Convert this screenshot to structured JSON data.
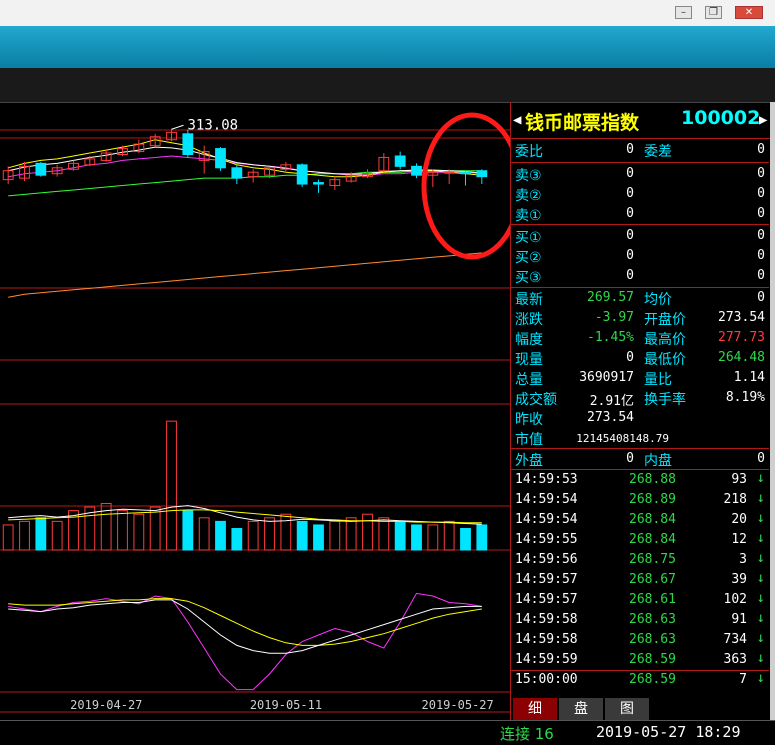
{
  "window": {
    "buttons": [
      "minimize",
      "restore",
      "close"
    ]
  },
  "chart_data": [
    {
      "type": "candlestick",
      "title": "",
      "high_label": "313.08",
      "x_dates": [
        "2019-04-27",
        "2019-05-11",
        "2019-05-27"
      ],
      "candles": [
        {
          "o": 279,
          "c": 285,
          "h": 288,
          "l": 276,
          "up": true
        },
        {
          "o": 280,
          "c": 288,
          "h": 291,
          "l": 278,
          "up": true
        },
        {
          "o": 290,
          "c": 282,
          "h": 291,
          "l": 281,
          "up": false
        },
        {
          "o": 283,
          "c": 287,
          "h": 289,
          "l": 281,
          "up": true
        },
        {
          "o": 286,
          "c": 290,
          "h": 292,
          "l": 285,
          "up": true
        },
        {
          "o": 289,
          "c": 293,
          "h": 295,
          "l": 288,
          "up": true
        },
        {
          "o": 292,
          "c": 297,
          "h": 299,
          "l": 291,
          "up": true
        },
        {
          "o": 296,
          "c": 300,
          "h": 302,
          "l": 295,
          "up": true
        },
        {
          "o": 298,
          "c": 303,
          "h": 306,
          "l": 297,
          "up": true
        },
        {
          "o": 302,
          "c": 308,
          "h": 310,
          "l": 301,
          "up": true
        },
        {
          "o": 306,
          "c": 311,
          "h": 313.08,
          "l": 305,
          "up": true
        },
        {
          "o": 310,
          "c": 296,
          "h": 313,
          "l": 294,
          "up": false
        },
        {
          "o": 298,
          "c": 292,
          "h": 302,
          "l": 283,
          "up": true
        },
        {
          "o": 300,
          "c": 287,
          "h": 301,
          "l": 285,
          "up": false
        },
        {
          "o": 287,
          "c": 280,
          "h": 289,
          "l": 276,
          "up": false
        },
        {
          "o": 281,
          "c": 284,
          "h": 286,
          "l": 277,
          "up": true
        },
        {
          "o": 282,
          "c": 287,
          "h": 288,
          "l": 280,
          "up": true
        },
        {
          "o": 286,
          "c": 289,
          "h": 291,
          "l": 284,
          "up": true
        },
        {
          "o": 289,
          "c": 276,
          "h": 290,
          "l": 274,
          "up": false
        },
        {
          "o": 277,
          "c": 276,
          "h": 279,
          "l": 270,
          "up": false
        },
        {
          "o": 275,
          "c": 279,
          "h": 281,
          "l": 272,
          "up": true
        },
        {
          "o": 278,
          "c": 282,
          "h": 284,
          "l": 277,
          "up": true
        },
        {
          "o": 281,
          "c": 283,
          "h": 286,
          "l": 280,
          "up": true
        },
        {
          "o": 285,
          "c": 294,
          "h": 297,
          "l": 284,
          "up": true
        },
        {
          "o": 295,
          "c": 288,
          "h": 298,
          "l": 286,
          "up": false
        },
        {
          "o": 288,
          "c": 282,
          "h": 290,
          "l": 280,
          "up": false
        },
        {
          "o": 282,
          "c": 284,
          "h": 286,
          "l": 274,
          "up": true
        },
        {
          "o": 284,
          "c": 284,
          "h": 286,
          "l": 276,
          "up": true
        },
        {
          "o": 284,
          "c": 283,
          "h": 285,
          "l": 275,
          "up": false
        },
        {
          "o": 285,
          "c": 281,
          "h": 286,
          "l": 276,
          "up": false
        }
      ],
      "ma5": [
        287,
        290,
        292,
        293,
        295,
        297,
        299,
        301,
        303,
        306,
        304,
        302,
        297,
        293,
        289,
        287,
        286,
        284,
        283,
        282,
        281,
        281,
        282,
        284,
        285,
        285,
        285,
        284,
        283,
        282
      ],
      "ma10": [
        281,
        283,
        284,
        285,
        287,
        289,
        290,
        292,
        293,
        294,
        295,
        294,
        293,
        292,
        290,
        289,
        288,
        287,
        285,
        284,
        283,
        282,
        282,
        283,
        283,
        284,
        284,
        284,
        284,
        283
      ],
      "ma20": [
        268,
        269,
        270,
        271,
        272,
        273,
        274,
        275,
        276,
        277,
        278,
        279,
        280,
        280,
        280,
        281,
        281,
        282,
        282,
        283,
        283,
        283,
        284,
        284,
        284,
        285,
        285,
        285,
        285,
        285
      ],
      "ma60": [
        240,
        242,
        243,
        244,
        245,
        246,
        247,
        248,
        249,
        250,
        251,
        252,
        253,
        254,
        255,
        256,
        257,
        258,
        259,
        260,
        261,
        262,
        263,
        264,
        265,
        266,
        267,
        268,
        269,
        270
      ],
      "volume": [
        35,
        40,
        45,
        40,
        55,
        60,
        65,
        55,
        50,
        60,
        180,
        55,
        45,
        40,
        30,
        40,
        45,
        50,
        40,
        35,
        40,
        45,
        50,
        45,
        40,
        35,
        35,
        40,
        30,
        35
      ],
      "vol_ma5": [
        45,
        47,
        48,
        46,
        48,
        52,
        55,
        57,
        56,
        55,
        60,
        62,
        58,
        52,
        46,
        42,
        40,
        41,
        43,
        42,
        41,
        40,
        41,
        42,
        41,
        40,
        39,
        38,
        37,
        36
      ],
      "vol_ma10": [
        42,
        43,
        44,
        45,
        46,
        48,
        50,
        51,
        52,
        53,
        55,
        56,
        56,
        55,
        53,
        51,
        49,
        47,
        45,
        43,
        42,
        41,
        41,
        40,
        40,
        39,
        39,
        39,
        38,
        38
      ],
      "osc_main": [
        72,
        70,
        68,
        72,
        75,
        76,
        78,
        76,
        74,
        80,
        78,
        60,
        40,
        20,
        8,
        8,
        20,
        35,
        45,
        50,
        55,
        52,
        45,
        40,
        60,
        82,
        80,
        75,
        74,
        72
      ],
      "osc_k": [
        70,
        69,
        68,
        70,
        71,
        73,
        74,
        75,
        75,
        77,
        77,
        70,
        60,
        50,
        42,
        38,
        36,
        36,
        38,
        42,
        46,
        50,
        54,
        58,
        62,
        66,
        70,
        71,
        72,
        72
      ],
      "osc_d": [
        74,
        73,
        73,
        73,
        74,
        75,
        76,
        77,
        77,
        78,
        78,
        76,
        71,
        65,
        59,
        53,
        48,
        44,
        42,
        42,
        43,
        45,
        48,
        51,
        55,
        59,
        63,
        66,
        68,
        70
      ]
    }
  ],
  "quote": {
    "name": "钱币邮票指数",
    "code": "100002",
    "weibi_label": "委比",
    "weibi_val": "0",
    "weicha_label": "委差",
    "weicha_val": "0",
    "asks": [
      {
        "label": "卖③",
        "price": "0",
        "vol": "0"
      },
      {
        "label": "卖②",
        "price": "0",
        "vol": "0"
      },
      {
        "label": "卖①",
        "price": "0",
        "vol": "0"
      }
    ],
    "bids": [
      {
        "label": "买①",
        "price": "0",
        "vol": "0"
      },
      {
        "label": "买②",
        "price": "0",
        "vol": "0"
      },
      {
        "label": "买③",
        "price": "0",
        "vol": "0"
      }
    ],
    "stats": [
      {
        "l1": "最新",
        "v1": "269.57",
        "c1": "#2fd84a",
        "l2": "均价",
        "v2": "0",
        "c2": "#fff"
      },
      {
        "l1": "涨跌",
        "v1": "-3.97",
        "c1": "#2fd84a",
        "l2": "开盘价",
        "v2": "273.54",
        "c2": "#fff"
      },
      {
        "l1": "幅度",
        "v1": "-1.45%",
        "c1": "#2fd84a",
        "l2": "最高价",
        "v2": "277.73",
        "c2": "#ff3b3b"
      },
      {
        "l1": "现量",
        "v1": "0",
        "c1": "#fff",
        "l2": "最低价",
        "v2": "264.48",
        "c2": "#2fd84a"
      },
      {
        "l1": "总量",
        "v1": "3690917",
        "c1": "#fff",
        "l2": "量比",
        "v2": "1.14",
        "c2": "#fff"
      },
      {
        "l1": "成交额",
        "v1": "2.91亿",
        "c1": "#fff",
        "l2": "换手率",
        "v2": "8.19%",
        "c2": "#fff"
      },
      {
        "l1": "昨收",
        "v1": "273.54",
        "c1": "#fff",
        "l2": "",
        "v2": "",
        "c2": "#fff"
      },
      {
        "l1": "市值",
        "v1": "12145408148.79",
        "c1": "#fff",
        "l2": "",
        "v2": "",
        "c2": "#fff"
      }
    ],
    "outer_label": "外盘",
    "outer_val": "0",
    "inner_label": "内盘",
    "inner_val": "0"
  },
  "ticks": [
    {
      "t": "14:59:53",
      "p": "268.88",
      "v": "93",
      "a": "↓"
    },
    {
      "t": "14:59:54",
      "p": "268.89",
      "v": "218",
      "a": "↓"
    },
    {
      "t": "14:59:54",
      "p": "268.84",
      "v": "20",
      "a": "↓"
    },
    {
      "t": "14:59:55",
      "p": "268.84",
      "v": "12",
      "a": "↓"
    },
    {
      "t": "14:59:56",
      "p": "268.75",
      "v": "3",
      "a": "↓"
    },
    {
      "t": "14:59:57",
      "p": "268.67",
      "v": "39",
      "a": "↓"
    },
    {
      "t": "14:59:57",
      "p": "268.61",
      "v": "102",
      "a": "↓"
    },
    {
      "t": "14:59:58",
      "p": "268.63",
      "v": "91",
      "a": "↓"
    },
    {
      "t": "14:59:58",
      "p": "268.63",
      "v": "734",
      "a": "↓"
    },
    {
      "t": "14:59:59",
      "p": "268.59",
      "v": "363",
      "a": "↓"
    },
    {
      "t": "15:00:00",
      "p": "268.59",
      "v": "7",
      "a": "↓"
    }
  ],
  "tabs": [
    "细",
    "盘",
    "图"
  ],
  "status": {
    "conn": "连接 16",
    "datetime": "2019-05-27 18:29"
  },
  "colors": {
    "up": "#ff3b3b",
    "down": "#00e5ff",
    "ma5": "#ffffff",
    "ma10": "#ffff00",
    "ma20": "#ff33ff",
    "ma60": "#33ff33",
    "border": "#b01818"
  }
}
